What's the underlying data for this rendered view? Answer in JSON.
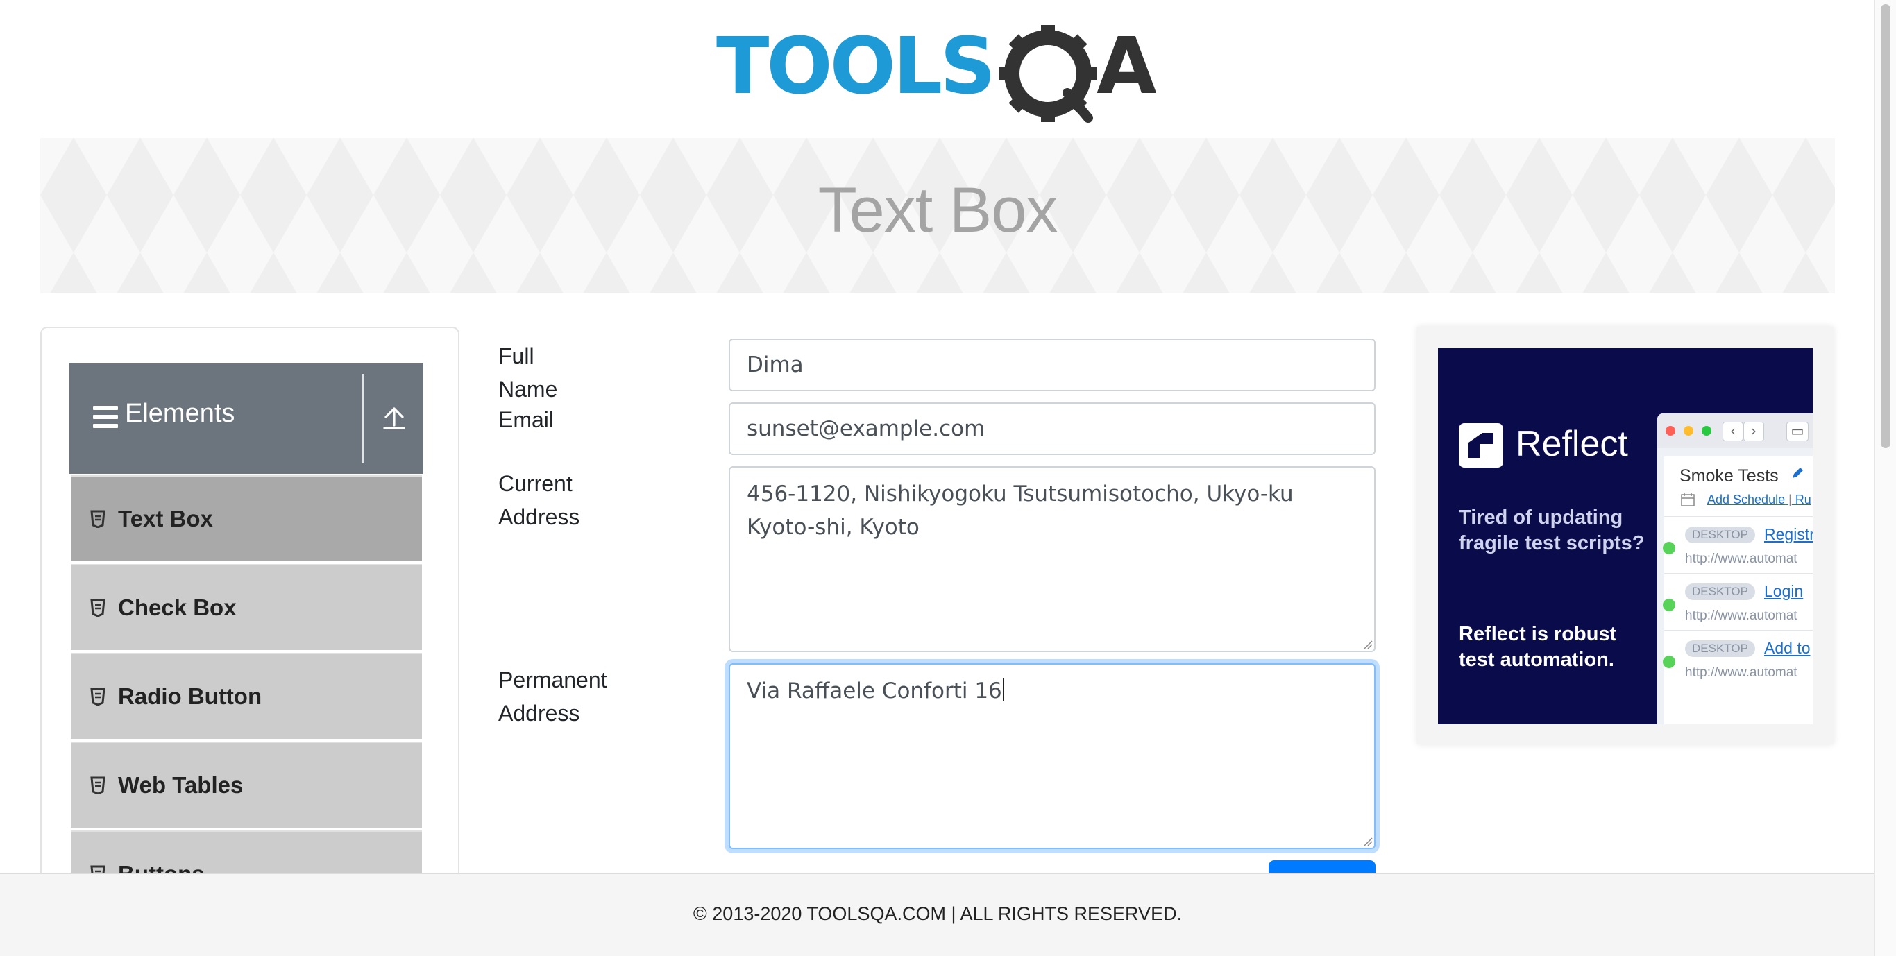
{
  "logo": {
    "brand_text_blue": "TOOLS",
    "brand_text_q": "Q",
    "brand_text_dark": "A",
    "colors": {
      "blue": "#1e9bd6",
      "dark": "#333333"
    }
  },
  "page_title": "Text Box",
  "sidebar": {
    "group_title": "Elements",
    "group_icon": "hamburger-icon",
    "collapse_icon": "upload-arrow-icon",
    "items": [
      {
        "label": "Text Box",
        "icon": "document-icon",
        "active": true
      },
      {
        "label": "Check Box",
        "icon": "document-icon",
        "active": false
      },
      {
        "label": "Radio Button",
        "icon": "document-icon",
        "active": false
      },
      {
        "label": "Web Tables",
        "icon": "document-icon",
        "active": false
      },
      {
        "label": "Buttons",
        "icon": "document-icon",
        "active": false
      }
    ]
  },
  "form": {
    "full_name": {
      "label": "Full Name",
      "value": "Dima"
    },
    "email": {
      "label": "Email",
      "value": "sunset@example.com"
    },
    "current_address": {
      "label": "Current Address",
      "value": "456-1120, Nishikyogoku Tsutsumisotocho, Ukyo-ku Kyoto-shi, Kyoto"
    },
    "permanent_address": {
      "label": "Permanent Address",
      "value": "Via Raffaele Conforti 16"
    },
    "submit_color": "#007bff"
  },
  "ad": {
    "brand": "Reflect",
    "pitch": "Tired of updating fragile test scripts?",
    "tagline": "Reflect is robust test automation.",
    "window_title": "Smoke Tests",
    "schedule_link": "Add Schedule",
    "schedule_sep": "|",
    "schedule_more": "Ru",
    "rows": [
      {
        "tag": "DESKTOP",
        "test": "Registr",
        "url": "http://www.automat"
      },
      {
        "tag": "DESKTOP",
        "test": "Login",
        "url": "http://www.automat"
      },
      {
        "tag": "DESKTOP",
        "test": "Add to",
        "url": "http://www.automat"
      }
    ]
  },
  "footer": "© 2013-2020 TOOLSQA.COM | ALL RIGHTS RESERVED."
}
